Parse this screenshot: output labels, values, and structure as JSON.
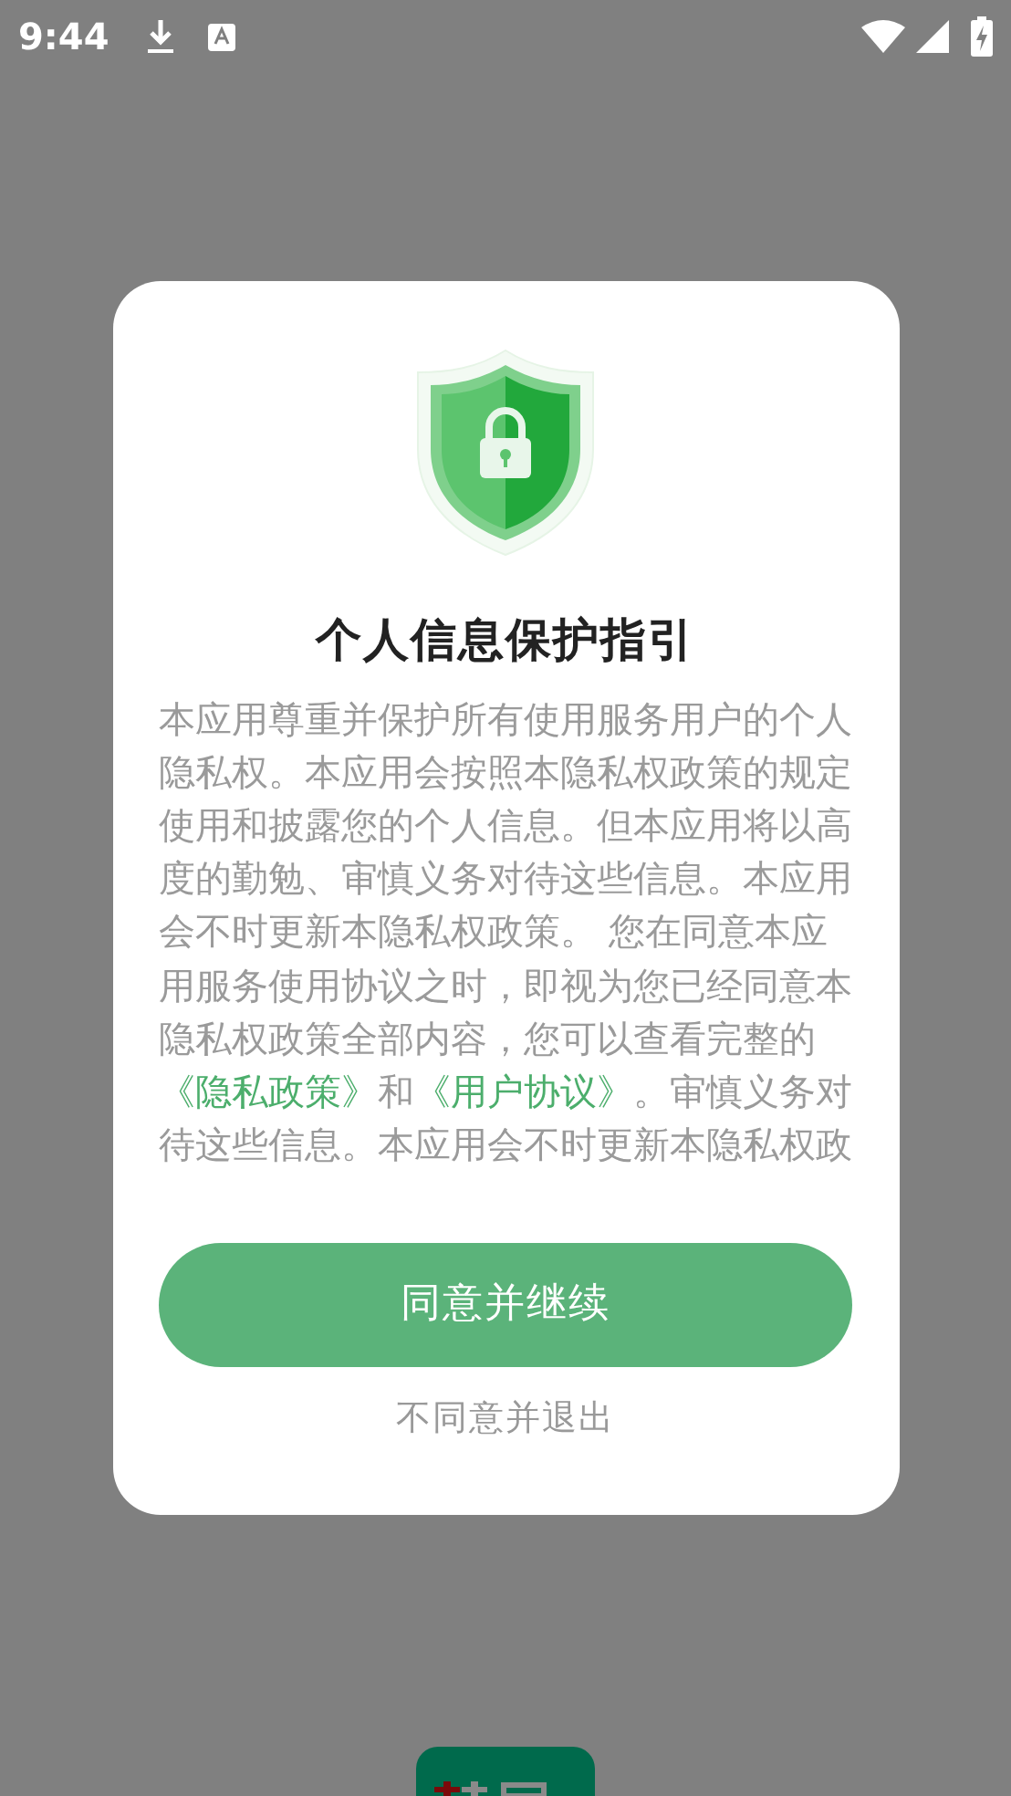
{
  "status_bar": {
    "time": "9:44"
  },
  "dialog": {
    "title": "个人信息保护指引",
    "body": [
      {
        "kind": "text",
        "text": "本应用尊重并保护所有使用服务用户的个人隐私权。本应用会按照本隐私权政策的规定使用和披露您的个人信息。但本应用将以高度的勤勉、审慎义务对待这些信息。本应用会不时更新本隐私权政策。 您在同意本应用服务使用协议之时，即视为您已经同意本隐私权政策全部内容，您可以查看完整的"
      },
      {
        "kind": "link",
        "text": "《隐私政策》"
      },
      {
        "kind": "text",
        "text": "和"
      },
      {
        "kind": "link",
        "text": "《用户协议》"
      },
      {
        "kind": "text",
        "text": "。审慎义务对待这些信息。本应用会不时更新本隐私权政"
      }
    ],
    "agree_button": "同意并继续",
    "decline_link": "不同意并退出"
  }
}
